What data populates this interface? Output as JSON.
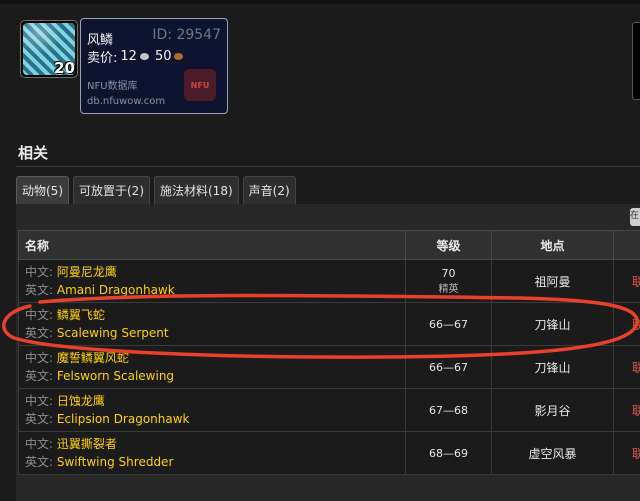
{
  "item": {
    "name": "风鳞",
    "id": "ID: 29547",
    "price_label": "卖价:",
    "silver": "12",
    "copper": "50",
    "stack": "20",
    "source": "NFU数据库",
    "url": "db.nfuwow.com",
    "logo": "NFU",
    "icon": "scale-icon",
    "accent": "#ffd100"
  },
  "section": {
    "title": "相关"
  },
  "tabs": [
    {
      "label": "动物(5)"
    },
    {
      "label": "可放置于(2)"
    },
    {
      "label": "施法材料(18)"
    },
    {
      "label": "声音(2)"
    }
  ],
  "corner": "在",
  "table": {
    "headers": [
      "名称",
      "等级",
      "地点",
      ""
    ],
    "zh_label": "中文:",
    "en_label": "英文:",
    "rows": [
      {
        "zh": "阿曼尼龙鹰",
        "en": "Amani Dragonhawk",
        "level": "70",
        "elite": "精英",
        "zone": "祖阿曼",
        "react": "联"
      },
      {
        "zh": "鳞翼飞蛇",
        "en": "Scalewing Serpent",
        "level": "66—67",
        "elite": "",
        "zone": "刀锋山",
        "react": "联"
      },
      {
        "zh": "魔誓鳞翼风蛇",
        "en": "Felsworn Scalewing",
        "level": "66—67",
        "elite": "",
        "zone": "刀锋山",
        "react": "联"
      },
      {
        "zh": "日蚀龙鹰",
        "en": "Eclipsion Dragonhawk",
        "level": "67—68",
        "elite": "",
        "zone": "影月谷",
        "react": "联"
      },
      {
        "zh": "迅翼撕裂者",
        "en": "Swiftwing Shredder",
        "level": "68—69",
        "elite": "",
        "zone": "虚空风暴",
        "react": "联"
      }
    ]
  }
}
